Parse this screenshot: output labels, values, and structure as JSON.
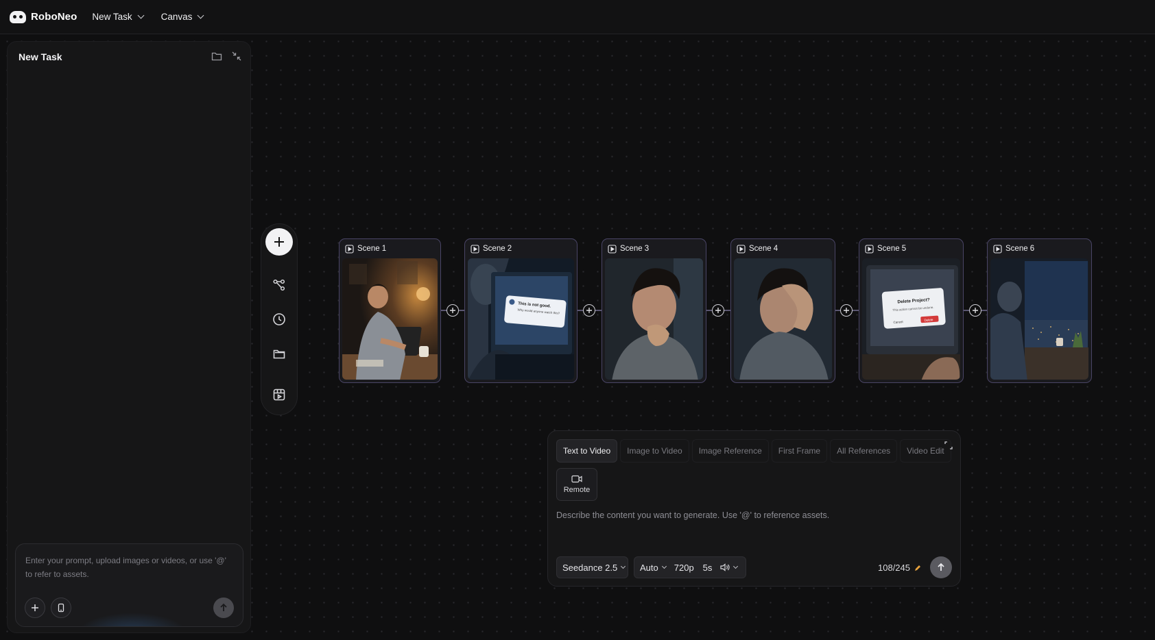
{
  "app": {
    "name": "RoboNeo"
  },
  "topbar": {
    "menus": [
      {
        "label": "New Task"
      },
      {
        "label": "Canvas"
      }
    ]
  },
  "left_panel": {
    "title": "New Task",
    "prompt_placeholder": "Enter your prompt, upload images or videos, or use '@' to refer to assets.",
    "icons": [
      "folder-icon",
      "collapse-icon",
      "plus-icon",
      "phone-icon",
      "send-arrow-icon"
    ]
  },
  "toolbar": {
    "icons": [
      "add-icon",
      "workflow-icon",
      "history-icon",
      "folder-icon",
      "storyboard-icon"
    ]
  },
  "scenes": [
    {
      "label": "Scene 1"
    },
    {
      "label": "Scene 2",
      "dialog_title": "This is not good.",
      "dialog_text": "Why would anyone watch this?"
    },
    {
      "label": "Scene 3"
    },
    {
      "label": "Scene 4"
    },
    {
      "label": "Scene 5",
      "dialog_title": "Delete Project?",
      "dialog_text": "This action cannot be undone.",
      "cancel": "Cancel",
      "delete": "Delete"
    },
    {
      "label": "Scene 6"
    }
  ],
  "generate": {
    "tabs": [
      "Text to Video",
      "Image to Video",
      "Image Reference",
      "First Frame",
      "All References",
      "Video Edit"
    ],
    "active_tab": "Text to Video",
    "remote_label": "Remote",
    "input_placeholder": "Describe the content you want to generate. Use '@' to reference assets.",
    "model": "Seedance 2.5",
    "ratio": "Auto",
    "resolution": "720p",
    "duration": "5s",
    "credits": "108/245"
  },
  "colors": {
    "accent_border": "#4a4566",
    "credit_icon": "#e8a23c",
    "delete_red": "#d33a3a"
  }
}
